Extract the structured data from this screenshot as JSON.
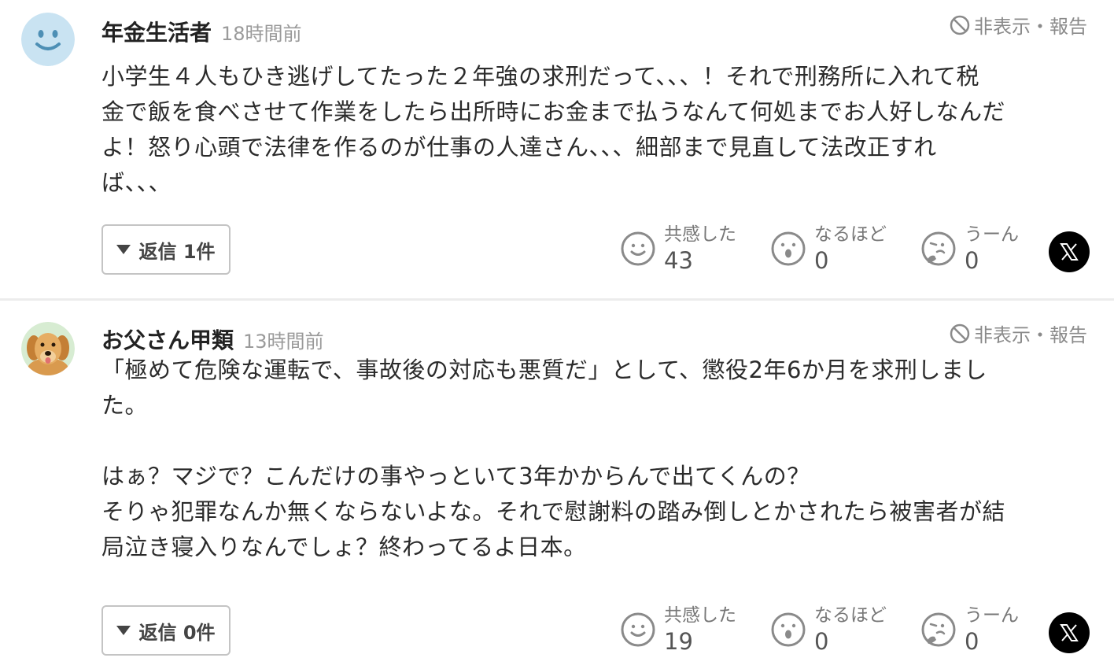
{
  "report_label": "非表示・報告",
  "comments": [
    {
      "username": "年金生活者",
      "time": "18時間前",
      "body": [
        "小学生４人もひき逃げしてたった２年強の求刑だって、、、！それで刑務所に入れて税",
        "金で飯を食べさせて作業をしたら出所時にお金まで払うなんて何処までお人好しなんだ",
        "よ！怒り心頭で法律を作るのが仕事の人達さん、、、細部まで見直して法改正すれ",
        "ば、、、"
      ],
      "reply_label": "返信 1件",
      "reactions": [
        {
          "label": "共感した",
          "count": "43"
        },
        {
          "label": "なるほど",
          "count": "0"
        },
        {
          "label": "うーん",
          "count": "0"
        }
      ]
    },
    {
      "username": "お父さん甲類",
      "time": "13時間前",
      "body": [
        "「極めて危険な運転で、事故後の対応も悪質だ」として、懲役2年6か月を求刑しまし",
        "た。",
        "",
        "はぁ？マジで？こんだけの事やっといて3年かからんで出てくんの？",
        "そりゃ犯罪なんか無くならないよな。それで慰謝料の踏み倒しとかされたら被害者が結",
        "局泣き寝入りなんでしょ？終わってるよ日本。"
      ],
      "reply_label": "返信 0件",
      "reactions": [
        {
          "label": "共感した",
          "count": "19"
        },
        {
          "label": "なるほど",
          "count": "0"
        },
        {
          "label": "うーん",
          "count": "0"
        }
      ]
    }
  ],
  "icons": {
    "avatar1": "smiley-face-avatar",
    "avatar2": "dog-avatar",
    "report": "prohibit-icon",
    "reaction1": "smile-icon",
    "reaction2": "surprised-icon",
    "reaction3": "thinking-icon",
    "share": "x-logo-icon"
  },
  "colors": {
    "avatar_bg": "#c9e3f2",
    "avatar_face": "#4d8fb5",
    "divider": "#ececec",
    "x_button": "#000000"
  }
}
